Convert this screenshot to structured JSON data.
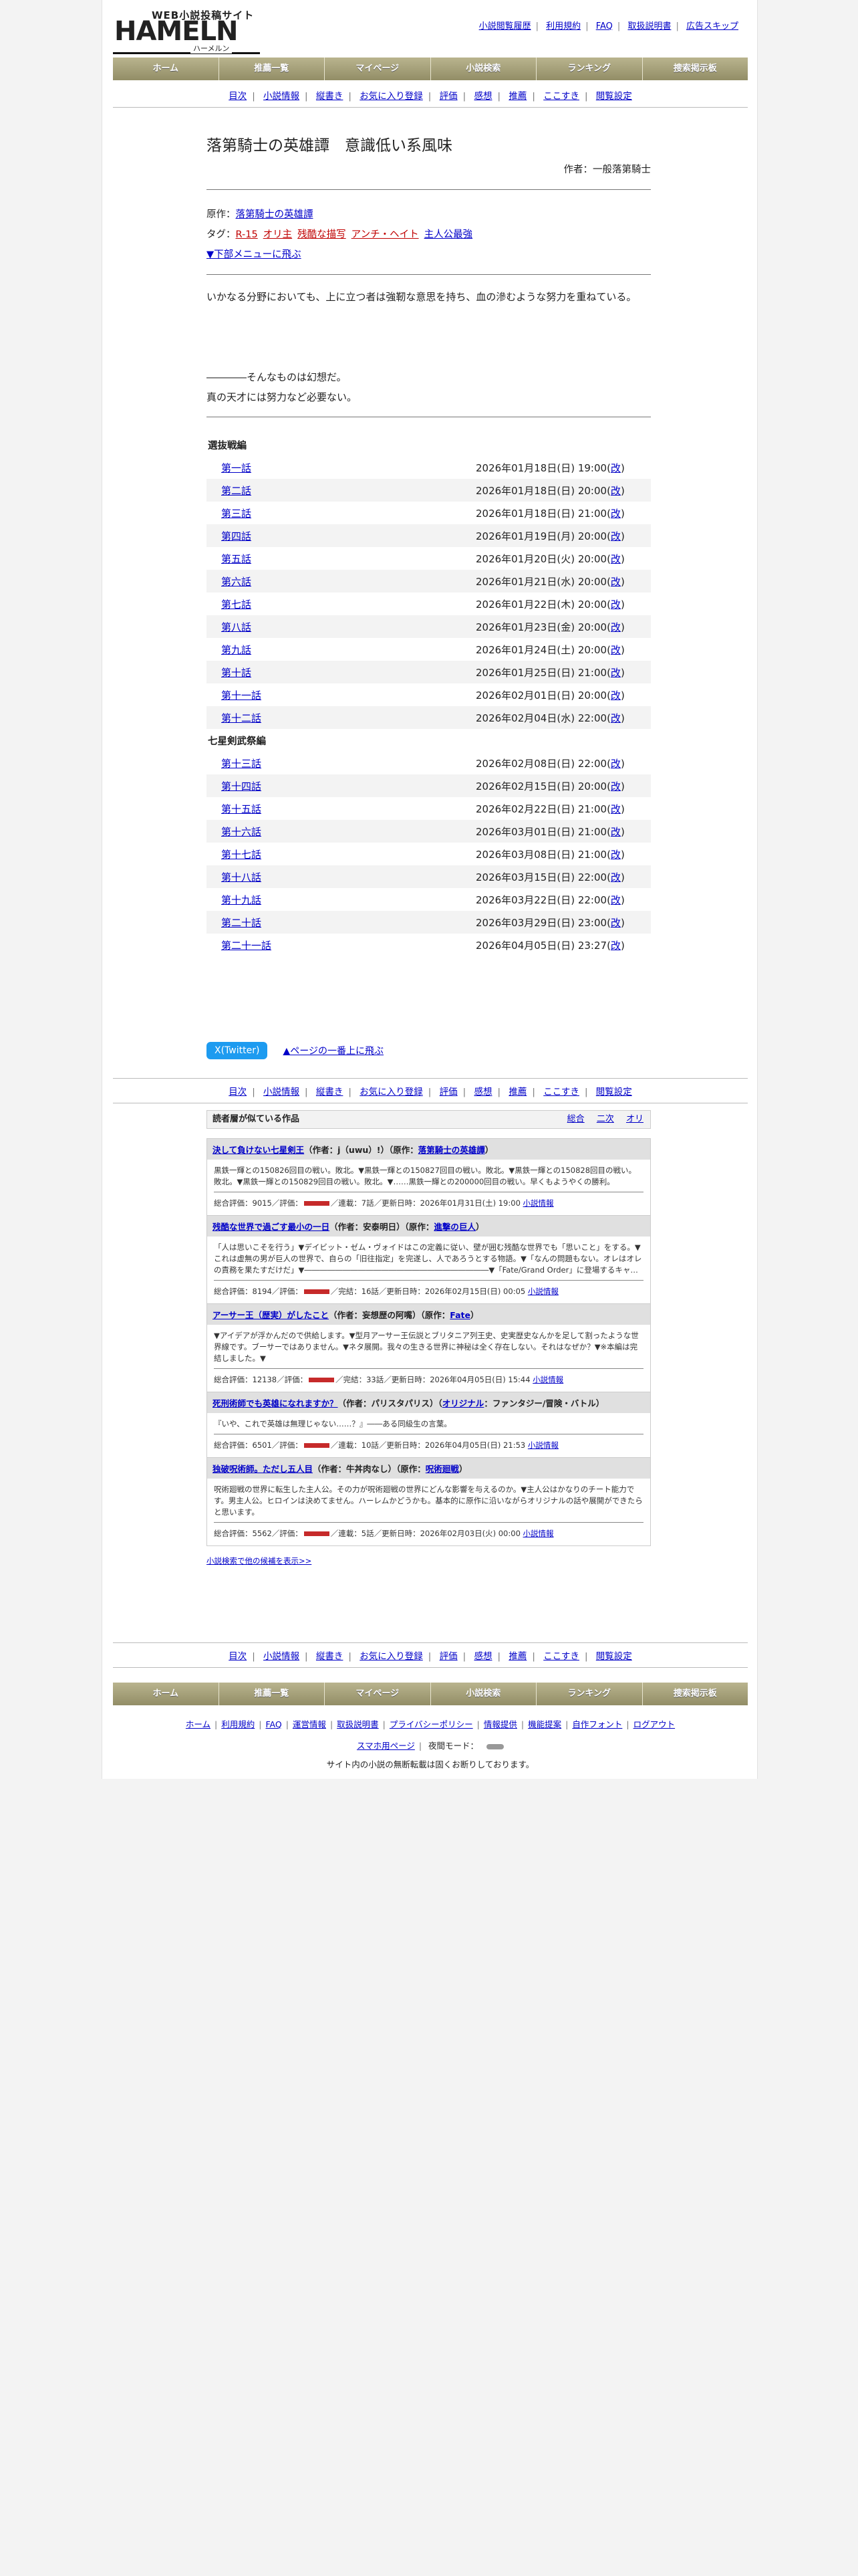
{
  "header": {
    "logo_top": "WEB小説投稿サイト",
    "logo_main": "HAMELN",
    "logo_sub": "ハーメルン",
    "links": [
      "小説閲覧履歴",
      "利用規約",
      "FAQ",
      "取扱説明書",
      "広告スキップ"
    ]
  },
  "global_nav": [
    "ホーム",
    "推薦一覧",
    "マイページ",
    "小説検索",
    "ランキング",
    "捜索掲示板"
  ],
  "sub_nav": [
    "目次",
    "小説情報",
    "縦書き",
    "お気に入り登録",
    "評価",
    "感想",
    "推薦",
    "ここすき",
    "閲覧設定"
  ],
  "novel": {
    "title": "落第騎士の英雄譚　意識低い系風味",
    "author": "作者：一般落第騎士",
    "original_label": "原作：",
    "original": "落第騎士の英雄譚",
    "tag_label": "タグ：",
    "tags": [
      {
        "text": "R-15",
        "red": true
      },
      {
        "text": "オリ主",
        "red": true
      },
      {
        "text": "残酷な描写",
        "red": true
      },
      {
        "text": "アンチ・ヘイト",
        "red": true
      },
      {
        "text": "主人公最強",
        "red": false
      }
    ],
    "jump_bottom": "▼下部メニューに飛ぶ",
    "preface": [
      "いかなる分野においても、上に立つ者は強靭な意思を持ち、血の滲むような努力を重ねている。",
      "",
      "",
      "",
      "――――そんなものは幻想だ。",
      "真の天才には努力など必要ない。"
    ]
  },
  "chapters": [
    {
      "name": "選抜戦編",
      "episodes": [
        {
          "title": "第一話",
          "date": "2026年01月18日(日) 19:00",
          "revised": "改"
        },
        {
          "title": "第二話",
          "date": "2026年01月18日(日) 20:00",
          "revised": "改"
        },
        {
          "title": "第三話",
          "date": "2026年01月18日(日) 21:00",
          "revised": "改"
        },
        {
          "title": "第四話",
          "date": "2026年01月19日(月) 20:00",
          "revised": "改"
        },
        {
          "title": "第五話",
          "date": "2026年01月20日(火) 20:00",
          "revised": "改"
        },
        {
          "title": "第六話",
          "date": "2026年01月21日(水) 20:00",
          "revised": "改"
        },
        {
          "title": "第七話",
          "date": "2026年01月22日(木) 20:00",
          "revised": "改"
        },
        {
          "title": "第八話",
          "date": "2026年01月23日(金) 20:00",
          "revised": "改"
        },
        {
          "title": "第九話",
          "date": "2026年01月24日(土) 20:00",
          "revised": "改"
        },
        {
          "title": "第十話",
          "date": "2026年01月25日(日) 21:00",
          "revised": "改"
        },
        {
          "title": "第十一話",
          "date": "2026年02月01日(日) 20:00",
          "revised": "改"
        },
        {
          "title": "第十二話",
          "date": "2026年02月04日(水) 22:00",
          "revised": "改"
        }
      ]
    },
    {
      "name": "七星剣武祭編",
      "episodes": [
        {
          "title": "第十三話",
          "date": "2026年02月08日(日) 22:00",
          "revised": "改"
        },
        {
          "title": "第十四話",
          "date": "2026年02月15日(日) 20:00",
          "revised": "改"
        },
        {
          "title": "第十五話",
          "date": "2026年02月22日(日) 21:00",
          "revised": "改"
        },
        {
          "title": "第十六話",
          "date": "2026年03月01日(日) 21:00",
          "revised": "改"
        },
        {
          "title": "第十七話",
          "date": "2026年03月08日(日) 21:00",
          "revised": "改"
        },
        {
          "title": "第十八話",
          "date": "2026年03月15日(日) 22:00",
          "revised": "改"
        },
        {
          "title": "第十九話",
          "date": "2026年03月22日(日) 22:00",
          "revised": "改"
        },
        {
          "title": "第二十話",
          "date": "2026年03月29日(日) 23:00",
          "revised": "改"
        },
        {
          "title": "第二十一話",
          "date": "2026年04月05日(日) 23:27",
          "revised": "改"
        }
      ]
    }
  ],
  "share": {
    "twitter": "X(Twitter)",
    "to_top": "▲ページの一番上に飛ぶ"
  },
  "recommend": {
    "heading": "読者層が似ている作品",
    "tabs": [
      "総合",
      "二次",
      "オリ"
    ],
    "items": [
      {
        "title": "決して負けない七星剣王",
        "author": "（作者：j（uwu）!）",
        "origin_prefix": "（原作：",
        "origin": "落第騎士の英雄譚",
        "origin_suffix": "）",
        "summary": "黒鉄一輝との150826回目の戦い。敗北。▼黒鉄一輝との150827回目の戦い。敗北。▼黒鉄一輝との150828回目の戦い。敗北。▼黒鉄一輝との150829回目の戦い。敗北。▼……黒鉄一輝との200000回目の戦い。早くもようやくの勝利。",
        "stats_a": "総合評価：9015／評価：",
        "stats_b": "／連載：7話／更新日時：2026年01月31日(土) 19:00",
        "info": "小説情報"
      },
      {
        "title": "残酷な世界で過ごす最小の一日",
        "author": "（作者：安泰明日）",
        "origin_prefix": "（原作：",
        "origin": "進撃の巨人",
        "origin_suffix": "）",
        "summary": "「人は思いこそを行う」▼デイビット・ゼム・ヴォイドはこの定義に従い、壁が囲む残酷な世界でも「思いこと」をする。▼これは虚無の男が巨人の世界で、自らの「旧往指定」を完遂し、人であろうとする物語。▼「なんの問題もない。オレはオレの責務を果たすだけだ」▼――――――――――――――――――――――――▼「Fate/Grand Order」に登場するキャ…",
        "stats_a": "総合評価：8194／評価：",
        "stats_b": "／完結：16話／更新日時：2026年02月15日(日) 00:05",
        "info": "小説情報"
      },
      {
        "title": "アーサー王（歴実）がしたこと",
        "author": "（作者：妄想歴の阿嘴）",
        "origin_prefix": "（原作：",
        "origin": "Fate",
        "origin_suffix": "）",
        "summary": "▼アイデアが浮かんだので供給します。▼型月アーサー王伝説とブリタニア列王史、史実歴史なんかを足して割ったような世界線です。ブーサーではありません。▼ネタ展開。我々の生きる世界に神秘は全く存在しない。それはなぜか？▼※本編は完結しました。▼",
        "stats_a": "総合評価：12138／評価：",
        "stats_b": "／完結：33話／更新日時：2026年04月05日(日) 15:44",
        "info": "小説情報"
      },
      {
        "title": "死刑術師でも英雄になれますか？",
        "author": "（作者：パリスタパリス）",
        "origin_prefix": "（",
        "origin": "オリジナル",
        "origin_suffix": "：ファンタジー/冒険・バトル）",
        "summary": "『いや、これで英雄は無理じゃない……？』――ある同級生の言葉。",
        "stats_a": "総合評価：6501／評価：",
        "stats_b": "／連載：10話／更新日時：2026年04月05日(日) 21:53",
        "info": "小説情報"
      },
      {
        "title": "独破呪術師。ただし五人目",
        "author": "（作者：牛丼肉なし）",
        "origin_prefix": "（原作：",
        "origin": "呪術廻戦",
        "origin_suffix": "）",
        "summary": "呪術廻戦の世界に転生した主人公。その力が呪術廻戦の世界にどんな影響を与えるのか。▼主人公はかなりのチート能力です。男主人公。ヒロインは決めてません。ハーレムかどうかも。基本的に原作に沿いながらオリジナルの話や展開ができたらと思います。",
        "stats_a": "総合評価：5562／評価：",
        "stats_b": "／連載：5話／更新日時：2026年02月03日(火) 00:00",
        "info": "小説情報"
      }
    ],
    "more": "小説検索で他の候補を表示>>"
  },
  "footer": {
    "links": [
      "ホーム",
      "利用規約",
      "FAQ",
      "運営情報",
      "取扱説明書",
      "プライバシーポリシー",
      "情報提供",
      "機能提案",
      "自作フォント",
      "ログアウト"
    ],
    "sp_link": "スマホ用ページ",
    "night_label": "夜間モード：",
    "notice": "サイト内の小説の無断転載は固くお断りしております。"
  }
}
